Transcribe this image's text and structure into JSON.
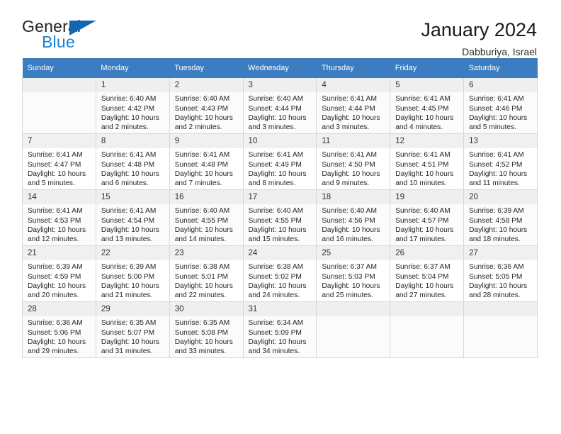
{
  "brand": {
    "name_top": "General",
    "name_bottom": "Blue"
  },
  "header": {
    "title": "January 2024",
    "subtitle": "Dabburiya, Israel"
  },
  "colors": {
    "header_blue": "#3b7dc0",
    "brand_blue": "#1d7fd4",
    "logo_triangle": "#1066b0",
    "daynum_bg": "#f0f0f0",
    "grid_line": "#d8d8d8"
  },
  "weekdays": [
    "Sunday",
    "Monday",
    "Tuesday",
    "Wednesday",
    "Thursday",
    "Friday",
    "Saturday"
  ],
  "weeks": [
    [
      {
        "day": "",
        "sunrise": "",
        "sunset": "",
        "daylight": ""
      },
      {
        "day": "1",
        "sunrise": "Sunrise: 6:40 AM",
        "sunset": "Sunset: 4:42 PM",
        "daylight": "Daylight: 10 hours and 2 minutes."
      },
      {
        "day": "2",
        "sunrise": "Sunrise: 6:40 AM",
        "sunset": "Sunset: 4:43 PM",
        "daylight": "Daylight: 10 hours and 2 minutes."
      },
      {
        "day": "3",
        "sunrise": "Sunrise: 6:40 AM",
        "sunset": "Sunset: 4:44 PM",
        "daylight": "Daylight: 10 hours and 3 minutes."
      },
      {
        "day": "4",
        "sunrise": "Sunrise: 6:41 AM",
        "sunset": "Sunset: 4:44 PM",
        "daylight": "Daylight: 10 hours and 3 minutes."
      },
      {
        "day": "5",
        "sunrise": "Sunrise: 6:41 AM",
        "sunset": "Sunset: 4:45 PM",
        "daylight": "Daylight: 10 hours and 4 minutes."
      },
      {
        "day": "6",
        "sunrise": "Sunrise: 6:41 AM",
        "sunset": "Sunset: 4:46 PM",
        "daylight": "Daylight: 10 hours and 5 minutes."
      }
    ],
    [
      {
        "day": "7",
        "sunrise": "Sunrise: 6:41 AM",
        "sunset": "Sunset: 4:47 PM",
        "daylight": "Daylight: 10 hours and 5 minutes."
      },
      {
        "day": "8",
        "sunrise": "Sunrise: 6:41 AM",
        "sunset": "Sunset: 4:48 PM",
        "daylight": "Daylight: 10 hours and 6 minutes."
      },
      {
        "day": "9",
        "sunrise": "Sunrise: 6:41 AM",
        "sunset": "Sunset: 4:48 PM",
        "daylight": "Daylight: 10 hours and 7 minutes."
      },
      {
        "day": "10",
        "sunrise": "Sunrise: 6:41 AM",
        "sunset": "Sunset: 4:49 PM",
        "daylight": "Daylight: 10 hours and 8 minutes."
      },
      {
        "day": "11",
        "sunrise": "Sunrise: 6:41 AM",
        "sunset": "Sunset: 4:50 PM",
        "daylight": "Daylight: 10 hours and 9 minutes."
      },
      {
        "day": "12",
        "sunrise": "Sunrise: 6:41 AM",
        "sunset": "Sunset: 4:51 PM",
        "daylight": "Daylight: 10 hours and 10 minutes."
      },
      {
        "day": "13",
        "sunrise": "Sunrise: 6:41 AM",
        "sunset": "Sunset: 4:52 PM",
        "daylight": "Daylight: 10 hours and 11 minutes."
      }
    ],
    [
      {
        "day": "14",
        "sunrise": "Sunrise: 6:41 AM",
        "sunset": "Sunset: 4:53 PM",
        "daylight": "Daylight: 10 hours and 12 minutes."
      },
      {
        "day": "15",
        "sunrise": "Sunrise: 6:41 AM",
        "sunset": "Sunset: 4:54 PM",
        "daylight": "Daylight: 10 hours and 13 minutes."
      },
      {
        "day": "16",
        "sunrise": "Sunrise: 6:40 AM",
        "sunset": "Sunset: 4:55 PM",
        "daylight": "Daylight: 10 hours and 14 minutes."
      },
      {
        "day": "17",
        "sunrise": "Sunrise: 6:40 AM",
        "sunset": "Sunset: 4:55 PM",
        "daylight": "Daylight: 10 hours and 15 minutes."
      },
      {
        "day": "18",
        "sunrise": "Sunrise: 6:40 AM",
        "sunset": "Sunset: 4:56 PM",
        "daylight": "Daylight: 10 hours and 16 minutes."
      },
      {
        "day": "19",
        "sunrise": "Sunrise: 6:40 AM",
        "sunset": "Sunset: 4:57 PM",
        "daylight": "Daylight: 10 hours and 17 minutes."
      },
      {
        "day": "20",
        "sunrise": "Sunrise: 6:39 AM",
        "sunset": "Sunset: 4:58 PM",
        "daylight": "Daylight: 10 hours and 18 minutes."
      }
    ],
    [
      {
        "day": "21",
        "sunrise": "Sunrise: 6:39 AM",
        "sunset": "Sunset: 4:59 PM",
        "daylight": "Daylight: 10 hours and 20 minutes."
      },
      {
        "day": "22",
        "sunrise": "Sunrise: 6:39 AM",
        "sunset": "Sunset: 5:00 PM",
        "daylight": "Daylight: 10 hours and 21 minutes."
      },
      {
        "day": "23",
        "sunrise": "Sunrise: 6:38 AM",
        "sunset": "Sunset: 5:01 PM",
        "daylight": "Daylight: 10 hours and 22 minutes."
      },
      {
        "day": "24",
        "sunrise": "Sunrise: 6:38 AM",
        "sunset": "Sunset: 5:02 PM",
        "daylight": "Daylight: 10 hours and 24 minutes."
      },
      {
        "day": "25",
        "sunrise": "Sunrise: 6:37 AM",
        "sunset": "Sunset: 5:03 PM",
        "daylight": "Daylight: 10 hours and 25 minutes."
      },
      {
        "day": "26",
        "sunrise": "Sunrise: 6:37 AM",
        "sunset": "Sunset: 5:04 PM",
        "daylight": "Daylight: 10 hours and 27 minutes."
      },
      {
        "day": "27",
        "sunrise": "Sunrise: 6:36 AM",
        "sunset": "Sunset: 5:05 PM",
        "daylight": "Daylight: 10 hours and 28 minutes."
      }
    ],
    [
      {
        "day": "28",
        "sunrise": "Sunrise: 6:36 AM",
        "sunset": "Sunset: 5:06 PM",
        "daylight": "Daylight: 10 hours and 29 minutes."
      },
      {
        "day": "29",
        "sunrise": "Sunrise: 6:35 AM",
        "sunset": "Sunset: 5:07 PM",
        "daylight": "Daylight: 10 hours and 31 minutes."
      },
      {
        "day": "30",
        "sunrise": "Sunrise: 6:35 AM",
        "sunset": "Sunset: 5:08 PM",
        "daylight": "Daylight: 10 hours and 33 minutes."
      },
      {
        "day": "31",
        "sunrise": "Sunrise: 6:34 AM",
        "sunset": "Sunset: 5:09 PM",
        "daylight": "Daylight: 10 hours and 34 minutes."
      },
      {
        "day": "",
        "sunrise": "",
        "sunset": "",
        "daylight": ""
      },
      {
        "day": "",
        "sunrise": "",
        "sunset": "",
        "daylight": ""
      },
      {
        "day": "",
        "sunrise": "",
        "sunset": "",
        "daylight": ""
      }
    ]
  ]
}
